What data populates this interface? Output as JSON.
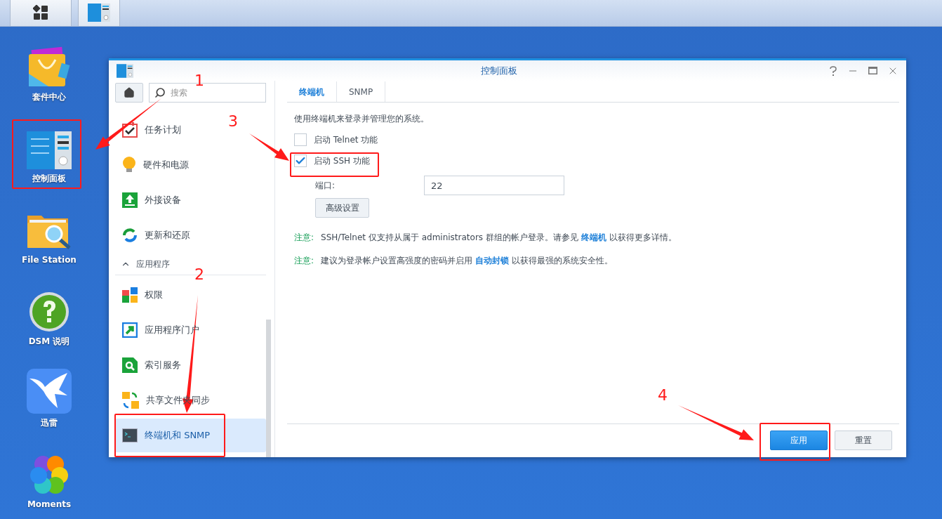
{
  "desktop_icons": [
    {
      "label": "套件中心"
    },
    {
      "label": "控制面板"
    },
    {
      "label": "File Station"
    },
    {
      "label": "DSM 说明"
    },
    {
      "label": "迅雷"
    },
    {
      "label": "Moments"
    }
  ],
  "window": {
    "title": "控制面板"
  },
  "sidebar": {
    "search": {
      "placeholder": "搜索"
    },
    "items": [
      {
        "label": "任务计划",
        "selected": false
      },
      {
        "label": "硬件和电源",
        "selected": false
      },
      {
        "label": "外接设备",
        "selected": false
      },
      {
        "label": "更新和还原",
        "selected": false
      }
    ],
    "section": {
      "label": "应用程序",
      "expanded": true,
      "items": [
        {
          "label": "权限",
          "selected": false
        },
        {
          "label": "应用程序门户",
          "selected": false
        },
        {
          "label": "索引服务",
          "selected": false
        },
        {
          "label": "共享文件夹同步",
          "selected": false
        },
        {
          "label": "终端机和 SNMP",
          "selected": true
        }
      ]
    }
  },
  "tabs": [
    {
      "label": "终端机",
      "selected": true
    },
    {
      "label": "SNMP",
      "selected": false
    }
  ],
  "description": "使用终端机来登录并管理您的系统。",
  "checkboxes": [
    {
      "label": "启动 Telnet 功能",
      "checked": false
    },
    {
      "label": "启动 SSH 功能",
      "checked": true
    }
  ],
  "port": {
    "label": "端口:",
    "value": "22"
  },
  "advanced_button": "高级设置",
  "notes": [
    {
      "label": "注意:",
      "before": "SSH/Telnet 仅支持从属于 administrators 群组的帐户登录。请参见",
      "link": "终端机",
      "after": "以获得更多详情。"
    },
    {
      "label": "注意:",
      "before": "建议为登录帐户设置高强度的密码并启用",
      "link": "自动封锁",
      "after": "以获得最强的系统安全性。"
    }
  ],
  "footer_buttons": [
    {
      "label": "应用",
      "kind": "primary"
    },
    {
      "label": "重置",
      "kind": "secondary"
    }
  ],
  "annotations": [
    {
      "text": "1"
    },
    {
      "text": "3"
    },
    {
      "text": "2"
    },
    {
      "text": "4"
    }
  ]
}
